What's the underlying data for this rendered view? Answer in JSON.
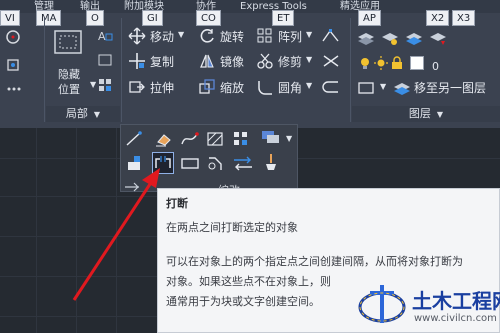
{
  "menubar": {
    "items": [
      "管理",
      "输出",
      "附加模块",
      "协作",
      "Express Tools",
      "精选应用"
    ]
  },
  "keytips": [
    "VI",
    "MA",
    "O",
    "GI",
    "CO",
    "ET",
    "AP",
    "X2",
    "X3"
  ],
  "ribbon": {
    "hide_label": "隐藏",
    "position_label": "位置",
    "local_panel_label": "局部",
    "modify": {
      "move": "移动",
      "rotate": "旋转",
      "array": "阵列",
      "copy": "复制",
      "mirror": "镜像",
      "trim": "修剪",
      "stretch": "拉伸",
      "scale": "缩放",
      "fillet": "圆角"
    },
    "layer": {
      "current_layer": "0",
      "move_to_layer": "移至另一图层",
      "panel_label": "图层"
    }
  },
  "flyout": {
    "label_partial": "编改"
  },
  "tooltip": {
    "title": "打断",
    "description": "在两点之间打断选定的对象",
    "detail_lines": [
      "可以在对象上的两个指定点之间创建间隔，从而将对象打断为",
      "对象。如果这些点不在对象上，则",
      "通常用于为块或文字创建空间。"
    ]
  },
  "watermark": {
    "title": "土木工程网",
    "url": "www.civilcn.com"
  },
  "colors": {
    "ribbon_bg": "#3b4250",
    "canvas_bg": "#252a31",
    "tooltip_bg": "#f4f5f7",
    "arrow": "#e0191f",
    "accent_blue": "#1a3fa0"
  }
}
